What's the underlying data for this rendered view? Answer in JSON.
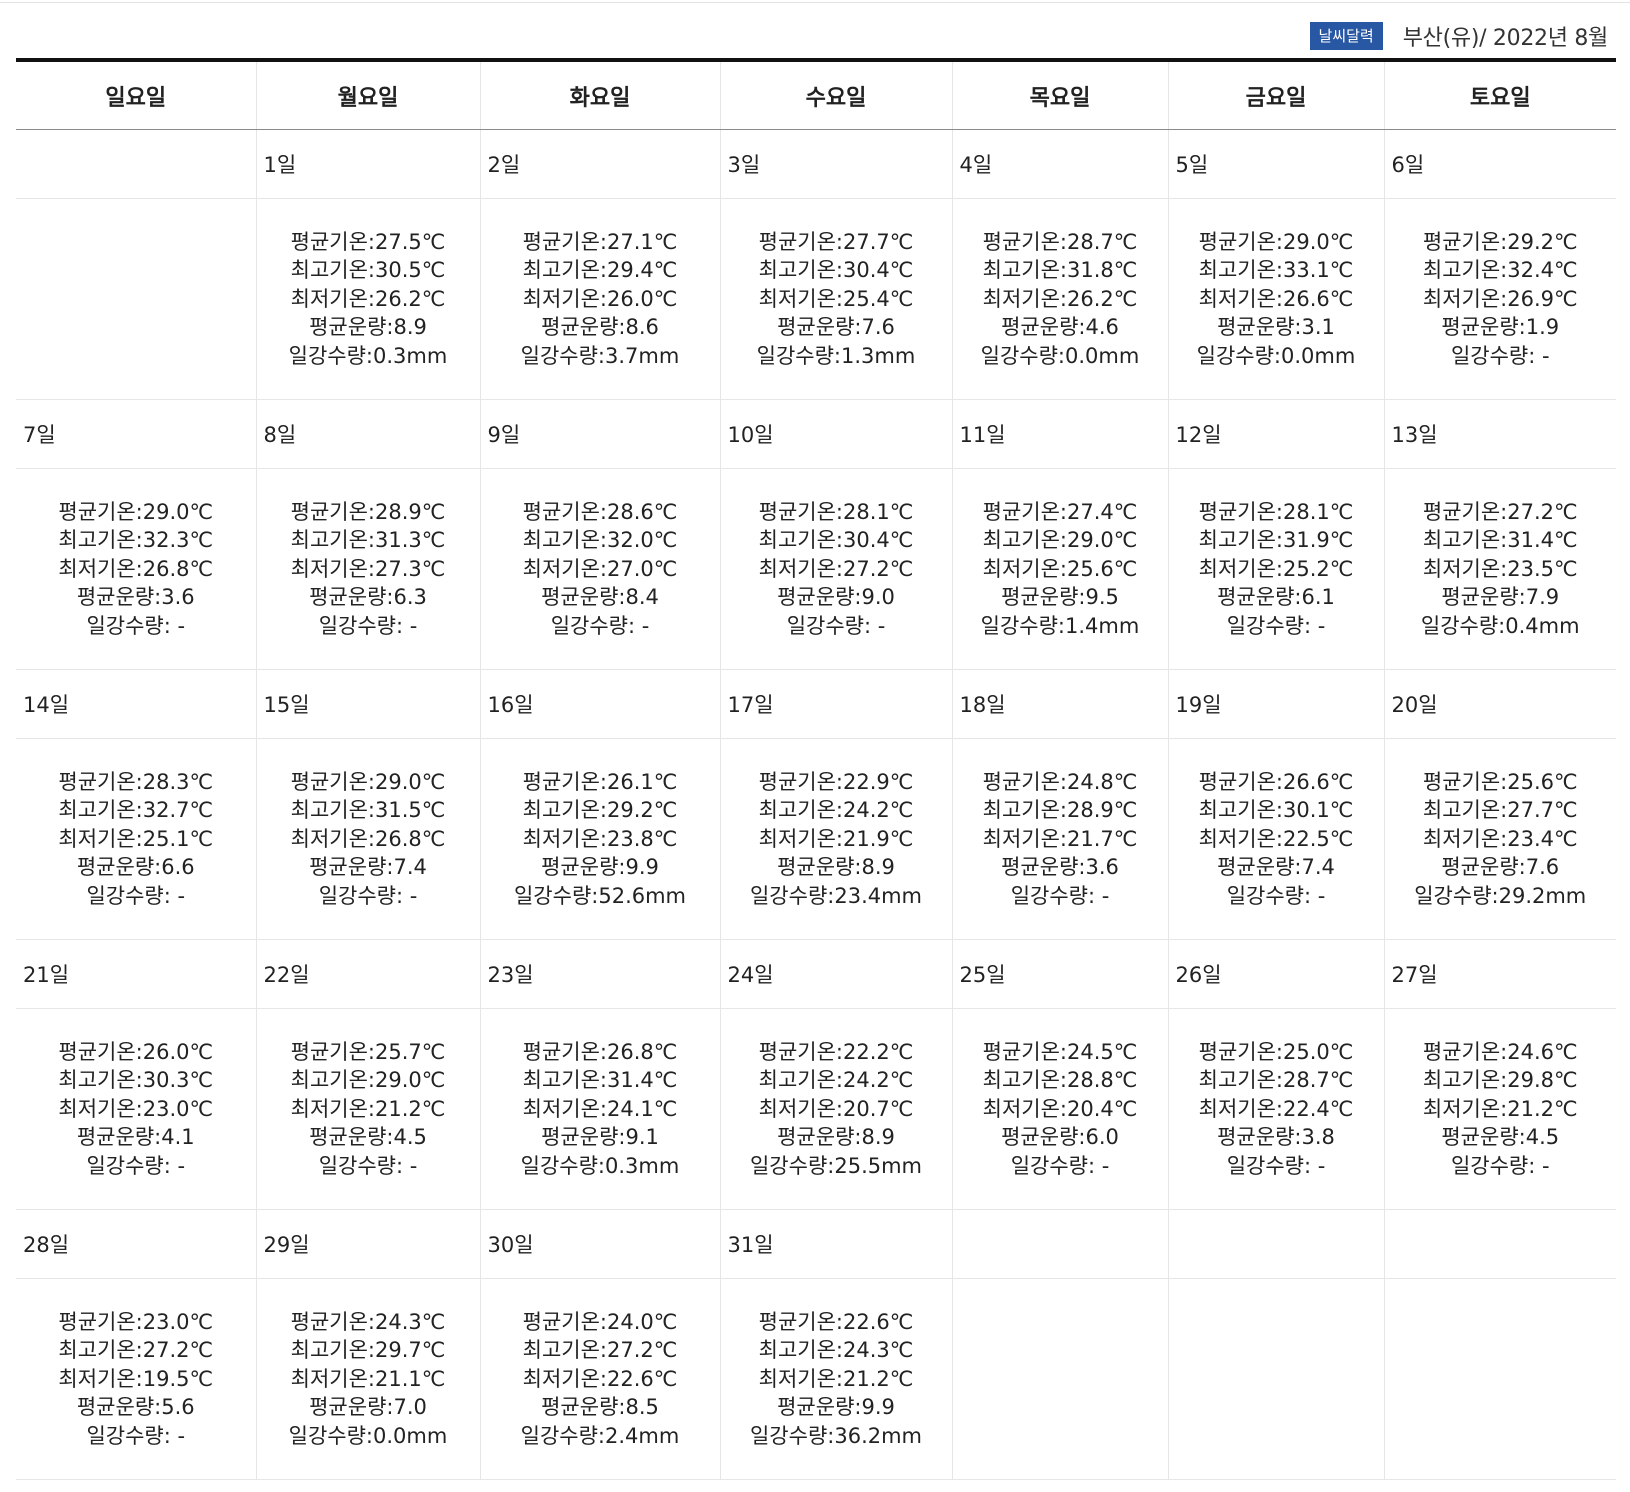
{
  "header": {
    "badge": "날씨달력",
    "location": "부산(유)/ 2022년 8월"
  },
  "weekdays": [
    "일요일",
    "월요일",
    "화요일",
    "수요일",
    "목요일",
    "금요일",
    "토요일"
  ],
  "labels": {
    "avg_temp": "평균기온:",
    "max_temp": "최고기온:",
    "min_temp": "최저기온:",
    "cloud": "평균운량:",
    "rain": "일강수량:"
  },
  "weeks": [
    [
      null,
      {
        "day": "1일",
        "avg_temp": "27.5℃",
        "max_temp": "30.5℃",
        "min_temp": "26.2℃",
        "cloud": "8.9",
        "rain": "0.3mm"
      },
      {
        "day": "2일",
        "avg_temp": "27.1℃",
        "max_temp": "29.4℃",
        "min_temp": "26.0℃",
        "cloud": "8.6",
        "rain": "3.7mm"
      },
      {
        "day": "3일",
        "avg_temp": "27.7℃",
        "max_temp": "30.4℃",
        "min_temp": "25.4℃",
        "cloud": "7.6",
        "rain": "1.3mm"
      },
      {
        "day": "4일",
        "avg_temp": "28.7℃",
        "max_temp": "31.8℃",
        "min_temp": "26.2℃",
        "cloud": "4.6",
        "rain": "0.0mm"
      },
      {
        "day": "5일",
        "avg_temp": "29.0℃",
        "max_temp": "33.1℃",
        "min_temp": "26.6℃",
        "cloud": "3.1",
        "rain": "0.0mm"
      },
      {
        "day": "6일",
        "avg_temp": "29.2℃",
        "max_temp": "32.4℃",
        "min_temp": "26.9℃",
        "cloud": "1.9",
        "rain": " -"
      }
    ],
    [
      {
        "day": "7일",
        "avg_temp": "29.0℃",
        "max_temp": "32.3℃",
        "min_temp": "26.8℃",
        "cloud": "3.6",
        "rain": " -"
      },
      {
        "day": "8일",
        "avg_temp": "28.9℃",
        "max_temp": "31.3℃",
        "min_temp": "27.3℃",
        "cloud": "6.3",
        "rain": " -"
      },
      {
        "day": "9일",
        "avg_temp": "28.6℃",
        "max_temp": "32.0℃",
        "min_temp": "27.0℃",
        "cloud": "8.4",
        "rain": " -"
      },
      {
        "day": "10일",
        "avg_temp": "28.1℃",
        "max_temp": "30.4℃",
        "min_temp": "27.2℃",
        "cloud": "9.0",
        "rain": " -"
      },
      {
        "day": "11일",
        "avg_temp": "27.4℃",
        "max_temp": "29.0℃",
        "min_temp": "25.6℃",
        "cloud": "9.5",
        "rain": "1.4mm"
      },
      {
        "day": "12일",
        "avg_temp": "28.1℃",
        "max_temp": "31.9℃",
        "min_temp": "25.2℃",
        "cloud": "6.1",
        "rain": " -"
      },
      {
        "day": "13일",
        "avg_temp": "27.2℃",
        "max_temp": "31.4℃",
        "min_temp": "23.5℃",
        "cloud": "7.9",
        "rain": "0.4mm"
      }
    ],
    [
      {
        "day": "14일",
        "avg_temp": "28.3℃",
        "max_temp": "32.7℃",
        "min_temp": "25.1℃",
        "cloud": "6.6",
        "rain": " -"
      },
      {
        "day": "15일",
        "avg_temp": "29.0℃",
        "max_temp": "31.5℃",
        "min_temp": "26.8℃",
        "cloud": "7.4",
        "rain": " -"
      },
      {
        "day": "16일",
        "avg_temp": "26.1℃",
        "max_temp": "29.2℃",
        "min_temp": "23.8℃",
        "cloud": "9.9",
        "rain": "52.6mm"
      },
      {
        "day": "17일",
        "avg_temp": "22.9℃",
        "max_temp": "24.2℃",
        "min_temp": "21.9℃",
        "cloud": "8.9",
        "rain": "23.4mm"
      },
      {
        "day": "18일",
        "avg_temp": "24.8℃",
        "max_temp": "28.9℃",
        "min_temp": "21.7℃",
        "cloud": "3.6",
        "rain": " -"
      },
      {
        "day": "19일",
        "avg_temp": "26.6℃",
        "max_temp": "30.1℃",
        "min_temp": "22.5℃",
        "cloud": "7.4",
        "rain": " -"
      },
      {
        "day": "20일",
        "avg_temp": "25.6℃",
        "max_temp": "27.7℃",
        "min_temp": "23.4℃",
        "cloud": "7.6",
        "rain": "29.2mm"
      }
    ],
    [
      {
        "day": "21일",
        "avg_temp": "26.0℃",
        "max_temp": "30.3℃",
        "min_temp": "23.0℃",
        "cloud": "4.1",
        "rain": " -"
      },
      {
        "day": "22일",
        "avg_temp": "25.7℃",
        "max_temp": "29.0℃",
        "min_temp": "21.2℃",
        "cloud": "4.5",
        "rain": " -"
      },
      {
        "day": "23일",
        "avg_temp": "26.8℃",
        "max_temp": "31.4℃",
        "min_temp": "24.1℃",
        "cloud": "9.1",
        "rain": "0.3mm"
      },
      {
        "day": "24일",
        "avg_temp": "22.2℃",
        "max_temp": "24.2℃",
        "min_temp": "20.7℃",
        "cloud": "8.9",
        "rain": "25.5mm"
      },
      {
        "day": "25일",
        "avg_temp": "24.5℃",
        "max_temp": "28.8℃",
        "min_temp": "20.4℃",
        "cloud": "6.0",
        "rain": " -"
      },
      {
        "day": "26일",
        "avg_temp": "25.0℃",
        "max_temp": "28.7℃",
        "min_temp": "22.4℃",
        "cloud": "3.8",
        "rain": " -"
      },
      {
        "day": "27일",
        "avg_temp": "24.6℃",
        "max_temp": "29.8℃",
        "min_temp": "21.2℃",
        "cloud": "4.5",
        "rain": " -"
      }
    ],
    [
      {
        "day": "28일",
        "avg_temp": "23.0℃",
        "max_temp": "27.2℃",
        "min_temp": "19.5℃",
        "cloud": "5.6",
        "rain": " -"
      },
      {
        "day": "29일",
        "avg_temp": "24.3℃",
        "max_temp": "29.7℃",
        "min_temp": "21.1℃",
        "cloud": "7.0",
        "rain": "0.0mm"
      },
      {
        "day": "30일",
        "avg_temp": "24.0℃",
        "max_temp": "27.2℃",
        "min_temp": "22.6℃",
        "cloud": "8.5",
        "rain": "2.4mm"
      },
      {
        "day": "31일",
        "avg_temp": "22.6℃",
        "max_temp": "24.3℃",
        "min_temp": "21.2℃",
        "cloud": "9.9",
        "rain": "36.2mm"
      },
      null,
      null,
      null
    ]
  ]
}
